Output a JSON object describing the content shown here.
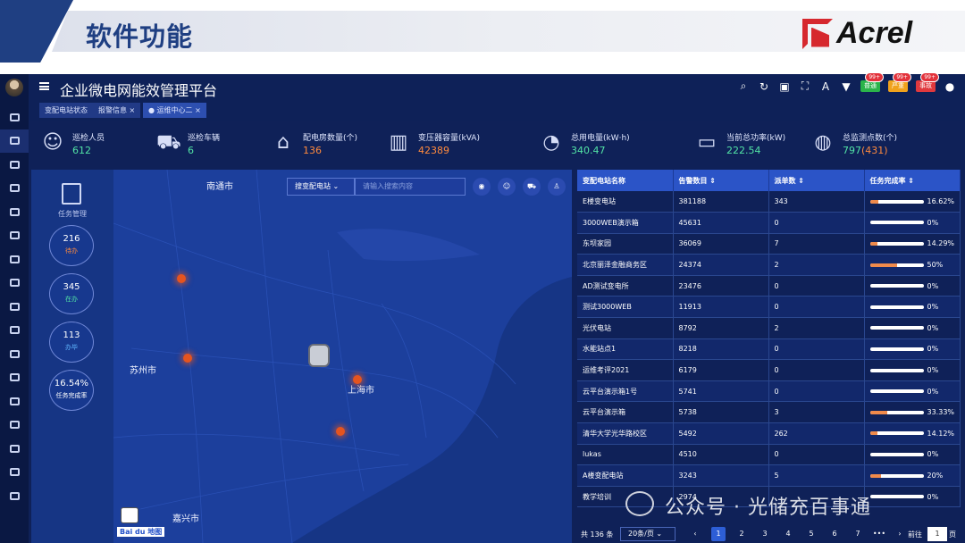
{
  "slide": {
    "title": "软件功能",
    "logo_text": "Acrel"
  },
  "app": {
    "title": "企业微电网能效管理平台",
    "tabs": [
      {
        "label": "变配电站状态"
      },
      {
        "label": "报警信息 ×"
      },
      {
        "label": "● 运维中心二 ×"
      }
    ],
    "toolbar": {
      "badges": [
        {
          "label": "普通",
          "count": "99+",
          "color": "#2bb44a"
        },
        {
          "label": "严重",
          "count": "99+",
          "color": "#f0a21c"
        },
        {
          "label": "事故",
          "count": "99+",
          "color": "#e0393e"
        }
      ]
    },
    "stats": [
      {
        "label": "巡检人员",
        "value": "612",
        "icon": "person-icon"
      },
      {
        "label": "巡检车辆",
        "value": "6",
        "icon": "car-icon"
      },
      {
        "label": "配电房数量(个)",
        "value": "136",
        "icon": "house-icon"
      },
      {
        "label": "变压器容量(kVA)",
        "value": "42389",
        "icon": "transformer-icon"
      },
      {
        "label": "总用电量(kW·h)",
        "value": "340.47",
        "icon": "meter-icon"
      },
      {
        "label": "当前总功率(kW)",
        "value": "222.54",
        "icon": "monitor-icon"
      },
      {
        "label": "总监测点数(个)",
        "value": "797",
        "value_extra": "(431)",
        "icon": "globe-icon"
      }
    ],
    "tasks": {
      "title": "任务管理",
      "items": [
        {
          "value": "216",
          "label": "待办",
          "color": "#ff8a3d"
        },
        {
          "value": "345",
          "label": "在办",
          "color": "#52e3a5"
        },
        {
          "value": "113",
          "label": "办毕",
          "color": "#5fb5ff"
        },
        {
          "value": "16.54%",
          "label": "任务完成率",
          "color": "#ffffff"
        }
      ]
    },
    "map": {
      "search_select": "搜变配电站 ⌄",
      "search_placeholder": "请输入搜索内容",
      "cities": [
        {
          "name": "南通市"
        },
        {
          "name": "苏州市"
        },
        {
          "name": "上海市"
        },
        {
          "name": "嘉兴市"
        }
      ],
      "attribution": "Bai du 地图"
    },
    "table": {
      "headers": [
        "变配电站名称",
        "告警数目 ⇕",
        "派单数 ⇕",
        "任务完成率 ⇕"
      ],
      "rows": [
        {
          "name": "E楼变电站",
          "alarms": "381188",
          "orders": "343",
          "rate": "16.62%",
          "frac": 0.1662
        },
        {
          "name": "3000WEB演示箱",
          "alarms": "45631",
          "orders": "0",
          "rate": "0%",
          "frac": 0
        },
        {
          "name": "东坝家园",
          "alarms": "36069",
          "orders": "7",
          "rate": "14.29%",
          "frac": 0.1429
        },
        {
          "name": "北京丽泽金融商务区",
          "alarms": "24374",
          "orders": "2",
          "rate": "50%",
          "frac": 0.5
        },
        {
          "name": "AD测试变电所",
          "alarms": "23476",
          "orders": "0",
          "rate": "0%",
          "frac": 0
        },
        {
          "name": "测试3000WEB",
          "alarms": "11913",
          "orders": "0",
          "rate": "0%",
          "frac": 0
        },
        {
          "name": "光伏电站",
          "alarms": "8792",
          "orders": "2",
          "rate": "0%",
          "frac": 0
        },
        {
          "name": "水能站点1",
          "alarms": "8218",
          "orders": "0",
          "rate": "0%",
          "frac": 0
        },
        {
          "name": "运维考评2021",
          "alarms": "6179",
          "orders": "0",
          "rate": "0%",
          "frac": 0
        },
        {
          "name": "云平台演示箱1号",
          "alarms": "5741",
          "orders": "0",
          "rate": "0%",
          "frac": 0
        },
        {
          "name": "云平台演示箱",
          "alarms": "5738",
          "orders": "3",
          "rate": "33.33%",
          "frac": 0.3333
        },
        {
          "name": "清华大学光华路校区",
          "alarms": "5492",
          "orders": "262",
          "rate": "14.12%",
          "frac": 0.1412
        },
        {
          "name": "lukas",
          "alarms": "4510",
          "orders": "0",
          "rate": "0%",
          "frac": 0
        },
        {
          "name": "A楼变配电站",
          "alarms": "3243",
          "orders": "5",
          "rate": "20%",
          "frac": 0.2
        },
        {
          "name": "教学培训",
          "alarms": "2974",
          "orders": "",
          "rate": "0%",
          "frac": 0
        }
      ],
      "pager": {
        "total": "共 136 条",
        "page_size": "20条/页 ⌄",
        "pages": [
          "1",
          "2",
          "3",
          "4",
          "5",
          "6",
          "7"
        ],
        "prev": "‹",
        "next": "›",
        "more": "•••",
        "goto_label": "前往",
        "goto_value": "1",
        "goto_suffix": "页"
      }
    }
  },
  "watermark": "公众号 · 光储充百事通"
}
